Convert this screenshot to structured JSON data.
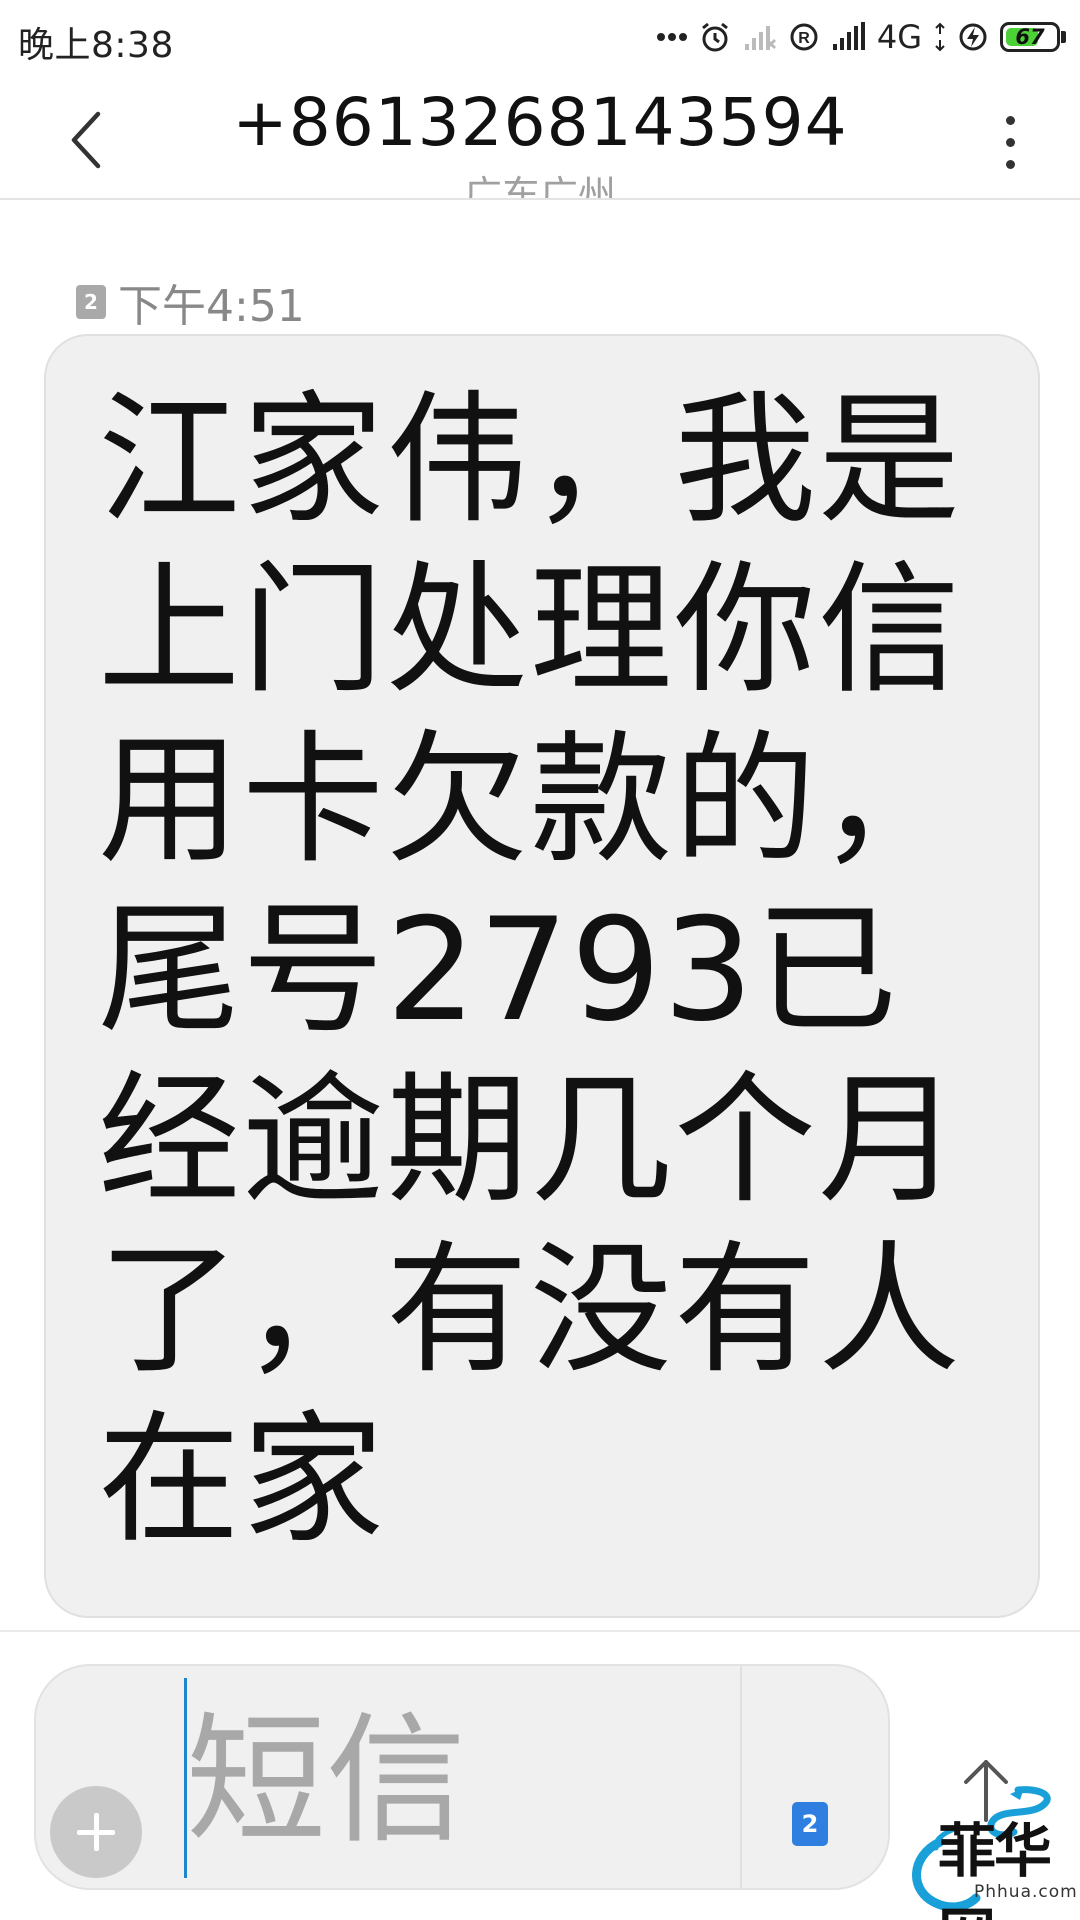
{
  "status_bar": {
    "time": "晚上8:38",
    "network": "4G",
    "battery": 67,
    "battery_color": "#4cd137"
  },
  "header": {
    "title": "+8613268143594",
    "subtitle": "广东广州",
    "back_icon": "chevron-left-icon",
    "more_icon": "more-vertical-icon"
  },
  "message": {
    "sim": "2",
    "time": "下午4:51",
    "text": "江家伟，我是\n上门处理你信\n用卡欠款的，\n尾号2793已\n经逾期几个月\n了，有没有人\n在家"
  },
  "composer": {
    "placeholder": "短信",
    "sim": "2",
    "add_icon": "plus-icon",
    "send_icon": "send-arrow-icon",
    "accent": "#2f7fe0"
  },
  "watermark": {
    "cn": "菲华网",
    "en": "Phhua.com"
  }
}
